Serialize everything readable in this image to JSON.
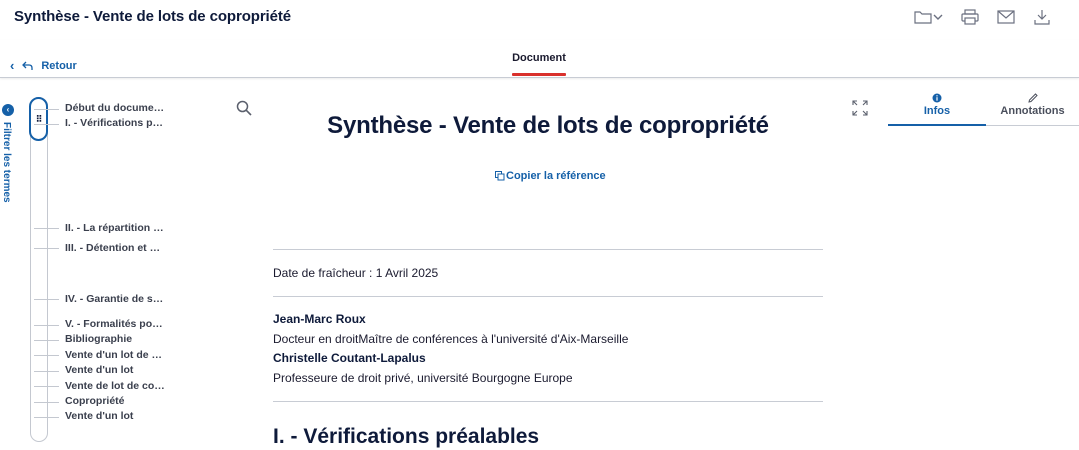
{
  "header": {
    "title": "Synthèse - Vente de lots de copropriété",
    "actions": [
      {
        "name": "folder-icon",
        "label": ""
      },
      {
        "name": "print-icon",
        "label": ""
      },
      {
        "name": "mail-icon",
        "label": ""
      },
      {
        "name": "download-icon",
        "label": ""
      }
    ]
  },
  "subbar": {
    "back_label": "Retour",
    "tab_label": "Document"
  },
  "filter": {
    "label": "Filtrer les termes"
  },
  "toc": {
    "items": [
      "Début du docume…",
      "I. - Vérifications p…",
      "II. - La répartition …",
      "III. - Détention et …",
      "IV. - Garantie de s…",
      "V. - Formalités po…",
      "Bibliographie",
      "Vente d'un lot de …",
      "Vente d'un lot",
      "Vente de lot de co…",
      "Copropriété",
      "Vente d'un lot"
    ]
  },
  "document": {
    "title": "Synthèse - Vente de lots de copropriété",
    "copy_ref": "Copier la référence",
    "freshness": "Date de fraîcheur : 1 Avril 2025",
    "authors": [
      {
        "name": "Jean-Marc Roux",
        "role": "Docteur en droitMaître de conférences à l'université d'Aix-Marseille"
      },
      {
        "name": "Christelle Coutant-Lapalus",
        "role": "Professeure de droit privé, université Bourgogne Europe"
      }
    ],
    "section_title": "I. - Vérifications préalables"
  },
  "right_panel": {
    "tabs": [
      {
        "label": "Infos",
        "icon": "info-icon",
        "active": true
      },
      {
        "label": "Annotations",
        "icon": "pencil-icon",
        "active": false
      }
    ]
  },
  "colors": {
    "accent": "#1560a8",
    "tab_underline": "#d9302c",
    "title": "#0e1a3a"
  }
}
